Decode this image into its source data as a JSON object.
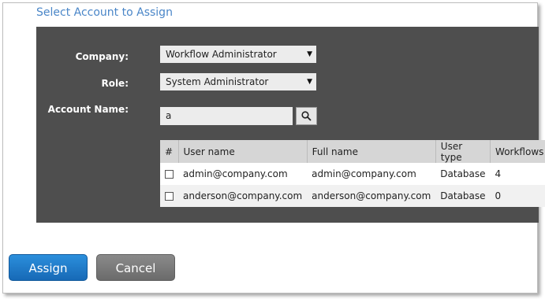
{
  "dialog": {
    "title": "Select Account to Assign"
  },
  "form": {
    "company_label": "Company:",
    "company_value": "Workflow Administrator",
    "role_label": "Role:",
    "role_value": "System Administrator",
    "account_label": "Account Name:",
    "account_value": "a"
  },
  "table": {
    "headers": [
      "#",
      "User name",
      "Full name",
      "User type",
      "Workflows"
    ],
    "rows": [
      {
        "checked": false,
        "user_name": "admin@company.com",
        "full_name": "admin@company.com",
        "user_type": "Database",
        "workflows": "4"
      },
      {
        "checked": false,
        "user_name": "anderson@company.com",
        "full_name": "anderson@company.com",
        "user_type": "Database",
        "workflows": "0"
      }
    ]
  },
  "buttons": {
    "assign": "Assign",
    "cancel": "Cancel"
  },
  "icons": {
    "dropdown": "chevron-down-icon",
    "search": "search-icon"
  },
  "colors": {
    "title": "#4a86c8",
    "panel": "#4e4e4e",
    "assign_button": "#1f7fd0",
    "cancel_button": "#7a7a7a"
  }
}
